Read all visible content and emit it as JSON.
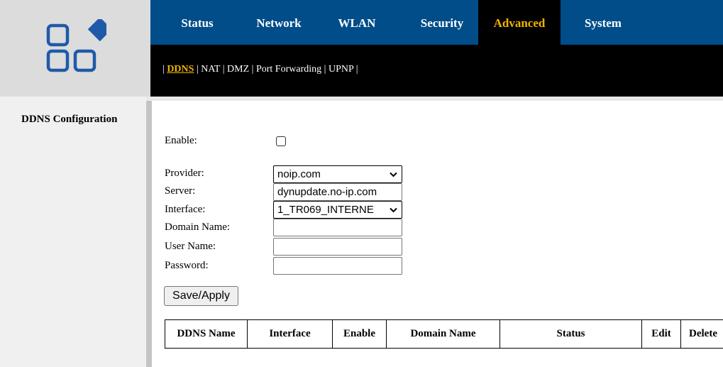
{
  "nav": {
    "tabs": [
      {
        "label": "Status"
      },
      {
        "label": "Network"
      },
      {
        "label": "WLAN"
      },
      {
        "label": "Security"
      },
      {
        "label": "Advanced",
        "active": true
      },
      {
        "label": "System"
      }
    ]
  },
  "subnav": {
    "items": [
      {
        "label": "DDNS",
        "active": true
      },
      {
        "label": "NAT"
      },
      {
        "label": "DMZ"
      },
      {
        "label": "Port Forwarding"
      },
      {
        "label": "UPNP"
      }
    ],
    "separator": "|"
  },
  "sidebar": {
    "items": [
      {
        "label": "DDNS Configuration"
      }
    ]
  },
  "form": {
    "enable_label": "Enable:",
    "enable_checked": false,
    "provider_label": "Provider:",
    "provider_value": "noip.com",
    "server_label": "Server:",
    "server_value": "dynupdate.no-ip.com",
    "interface_label": "Interface:",
    "interface_value": "1_TR069_INTERNE",
    "domain_label": "Domain Name:",
    "domain_value": "",
    "user_label": "User Name:",
    "user_value": "",
    "password_label": "Password:",
    "password_value": "",
    "save_label": "Save/Apply"
  },
  "table": {
    "headers": [
      "DDNS Name",
      "Interface",
      "Enable",
      "Domain Name",
      "Status",
      "Edit",
      "Delete"
    ]
  },
  "colors": {
    "nav_bg": "#004d8a",
    "active_tab": "#f0b400",
    "logo_blue": "#1e5aa8"
  },
  "icons": {
    "logo": "apps-grid-logo",
    "select_arrow": "chevron-down-icon"
  }
}
